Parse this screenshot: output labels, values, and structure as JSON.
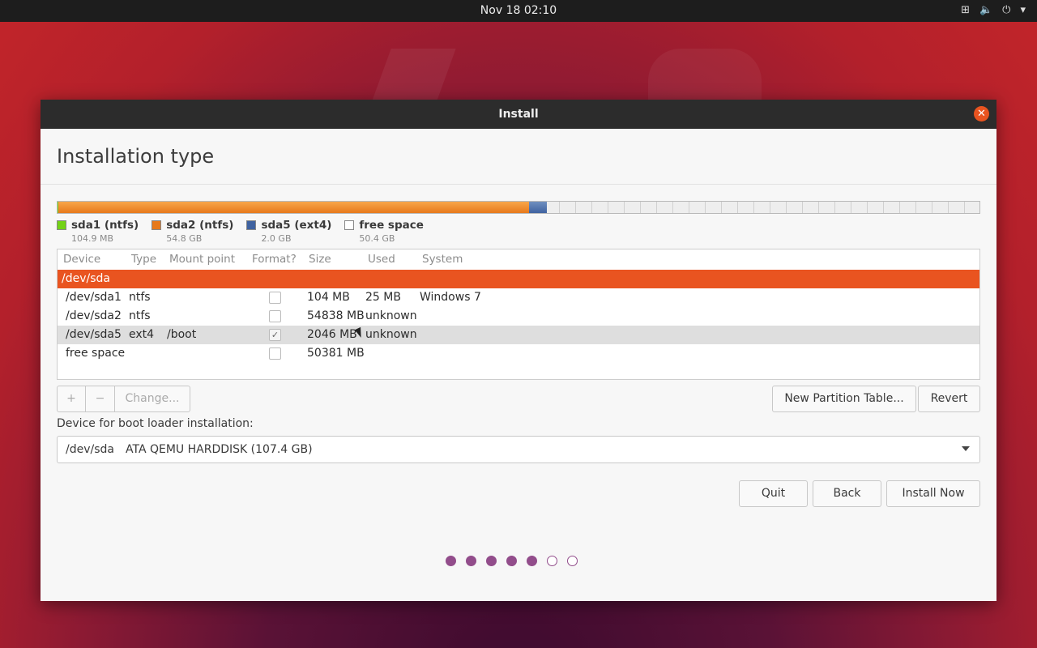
{
  "topbar": {
    "clock": "Nov 18  02:10",
    "tray_icons": [
      "network-icon",
      "volume-icon",
      "power-icon",
      "menu-arrow-icon"
    ]
  },
  "window": {
    "title": "Install",
    "close_icon": "close-icon"
  },
  "page": {
    "title": "Installation type"
  },
  "colors": {
    "sda1": "#73d216",
    "sda2": "#e7791b",
    "sda5": "#3f62a0",
    "free": "#eeeeee",
    "accent": "#e95420",
    "progress": "#924d8b"
  },
  "legend": [
    {
      "label": "sda1 (ntfs)",
      "size": "104.9 MB"
    },
    {
      "label": "sda2 (ntfs)",
      "size": "54.8 GB"
    },
    {
      "label": "sda5 (ext4)",
      "size": "2.0 GB"
    },
    {
      "label": "free space",
      "size": "50.4 GB"
    }
  ],
  "table": {
    "headers": [
      "Device",
      "Type",
      "Mount point",
      "Format?",
      "Size",
      "Used",
      "System"
    ],
    "disk": "/dev/sda",
    "rows": [
      {
        "device": "/dev/sda1",
        "type": "ntfs",
        "mount": "",
        "format": false,
        "size": "104 MB",
        "used": "25 MB",
        "system": "Windows 7"
      },
      {
        "device": "/dev/sda2",
        "type": "ntfs",
        "mount": "",
        "format": false,
        "size": "54838 MB",
        "used": "unknown",
        "system": ""
      },
      {
        "device": "/dev/sda5",
        "type": "ext4",
        "mount": "/boot",
        "format": true,
        "size": "2046 MB",
        "used": "unknown",
        "system": ""
      },
      {
        "device": "free space",
        "type": "",
        "mount": "",
        "format": false,
        "size": "50381 MB",
        "used": "",
        "system": ""
      }
    ]
  },
  "actions": {
    "add": "+",
    "remove": "−",
    "change": "Change...",
    "new_table": "New Partition Table...",
    "revert": "Revert"
  },
  "bootloader": {
    "label": "Device for boot loader installation:",
    "device": "/dev/sda",
    "description": "ATA QEMU HARDDISK (107.4 GB)"
  },
  "nav": {
    "quit": "Quit",
    "back": "Back",
    "install": "Install Now"
  },
  "progress": {
    "current": 5,
    "total": 7
  }
}
